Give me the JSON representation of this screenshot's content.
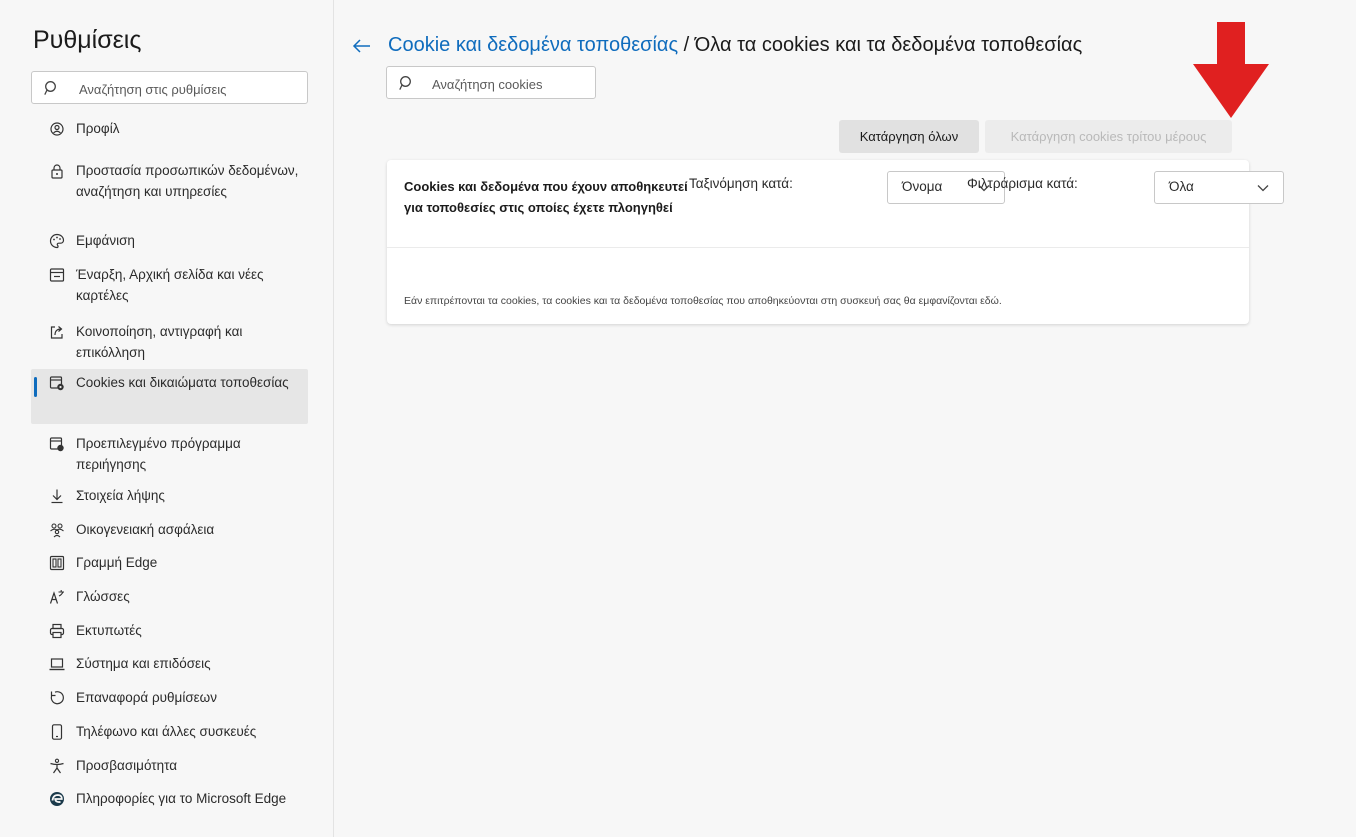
{
  "sidebar": {
    "title": "Ρυθμίσεις",
    "search_placeholder": "Αναζήτηση στις ρυθμίσεις",
    "items": [
      {
        "label": "Προφίλ",
        "icon": "profile-icon"
      },
      {
        "label": "Προστασία προσωπικών δεδομένων, αναζήτηση και υπηρεσίες",
        "icon": "lock-icon"
      },
      {
        "label": "Εμφάνιση",
        "icon": "palette-icon"
      },
      {
        "label": "Έναρξη, Αρχική σελίδα και νέες καρτέλες",
        "icon": "new-tab-icon"
      },
      {
        "label": "Κοινοποίηση, αντιγραφή και επικόλληση",
        "icon": "share-icon"
      },
      {
        "label": "Cookies και δικαιώματα τοποθεσίας",
        "icon": "cookies-permissions-icon",
        "selected": true
      },
      {
        "label": "Προεπιλεγμένο πρόγραμμα περιήγησης",
        "icon": "default-browser-icon"
      },
      {
        "label": "Στοιχεία λήψης",
        "icon": "download-icon"
      },
      {
        "label": "Οικογενειακή ασφάλεια",
        "icon": "family-icon"
      },
      {
        "label": "Γραμμή Edge",
        "icon": "edge-bar-icon"
      },
      {
        "label": "Γλώσσες",
        "icon": "languages-icon"
      },
      {
        "label": "Εκτυπωτές",
        "icon": "printer-icon"
      },
      {
        "label": "Σύστημα και επιδόσεις",
        "icon": "laptop-icon"
      },
      {
        "label": "Επαναφορά ρυθμίσεων",
        "icon": "reset-icon"
      },
      {
        "label": "Τηλέφωνο και άλλες συσκευές",
        "icon": "phone-icon"
      },
      {
        "label": "Προσβασιμότητα",
        "icon": "accessibility-icon"
      },
      {
        "label": "Πληροφορίες για το Microsoft Edge",
        "icon": "edge-logo-icon"
      }
    ]
  },
  "header": {
    "breadcrumb_link": "Cookie και δεδομένα τοποθεσίας",
    "separator": " / ",
    "title": "Όλα τα cookies και τα δεδομένα τοποθεσίας"
  },
  "cookie_search": {
    "placeholder": "Αναζήτηση cookies"
  },
  "actions": {
    "remove_all": "Κατάργηση όλων",
    "remove_third_party": "Κατάργηση cookies τρίτου μέρους"
  },
  "card": {
    "description": "Cookies και δεδομένα που έχουν αποθηκευτεί για τοποθεσίες στις οποίες έχετε πλοηγηθεί",
    "sort_label": "Ταξινόμηση κατά:",
    "sort_value": "Όνομα",
    "filter_label": "Φιλτράρισμα κατά:",
    "filter_value": "Όλα",
    "empty_message": "Εάν επιτρέπονται τα cookies, τα cookies και τα δεδομένα τοποθεσίας που αποθηκεύονται στη συσκευή σας θα εμφανίζονται εδώ."
  },
  "colors": {
    "accent": "#0f6cbd",
    "annotation_arrow": "#e02020",
    "background": "#f7f7f7",
    "selected_item": "#e6e6e6"
  },
  "annotation": {
    "icon": "red-arrow-pointer"
  }
}
